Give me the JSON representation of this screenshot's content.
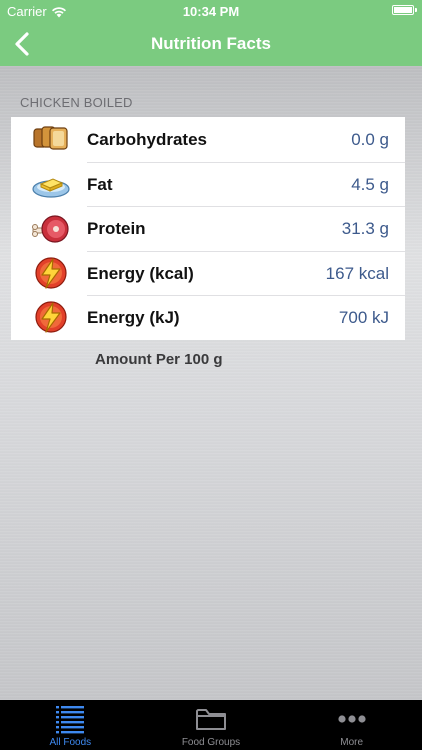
{
  "status_bar": {
    "carrier": "Carrier",
    "time": "10:34 PM"
  },
  "nav": {
    "title": "Nutrition Facts",
    "back_icon": "chevron-left-icon"
  },
  "section": {
    "header": "CHICKEN BOILED"
  },
  "rows": [
    {
      "label": "Carbohydrates",
      "value": "0.0 g",
      "icon": "bread-icon"
    },
    {
      "label": "Fat",
      "value": "4.5 g",
      "icon": "butter-icon"
    },
    {
      "label": "Protein",
      "value": "31.3 g",
      "icon": "meat-icon"
    },
    {
      "label": "Energy (kcal)",
      "value": "167 kcal",
      "icon": "energy-bolt-icon"
    },
    {
      "label": "Energy (kJ)",
      "value": "700 kJ",
      "icon": "energy-bolt-icon"
    }
  ],
  "footnote": "Amount Per 100 g",
  "tabs": [
    {
      "label": "All Foods",
      "icon": "list-icon",
      "active": true
    },
    {
      "label": "Food Groups",
      "icon": "folder-icon",
      "active": false
    },
    {
      "label": "More",
      "icon": "more-dots-icon",
      "active": false
    }
  ],
  "colors": {
    "nav_green": "#7bcb80",
    "value_blue": "#3d5a8c",
    "tab_active": "#3e89f0",
    "tab_inactive": "#8e8e93"
  }
}
